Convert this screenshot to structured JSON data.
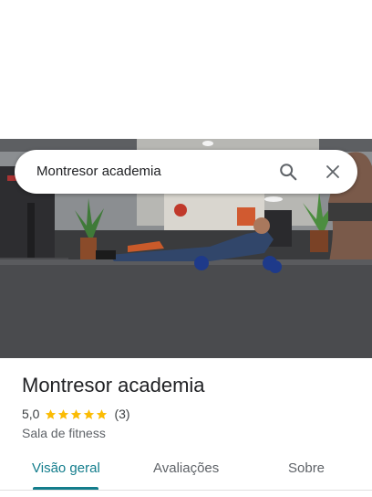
{
  "search": {
    "query": "Montresor academia"
  },
  "place": {
    "name": "Montresor academia",
    "rating": "5,0",
    "rating_value": 5.0,
    "review_count": "(3)",
    "category": "Sala de fitness",
    "star_color": "#fbbc04"
  },
  "tabs": [
    {
      "label": "Visão geral",
      "active": true
    },
    {
      "label": "Avaliações",
      "active": false
    },
    {
      "label": "Sobre",
      "active": false
    }
  ],
  "colors": {
    "accent": "#137d8c"
  }
}
